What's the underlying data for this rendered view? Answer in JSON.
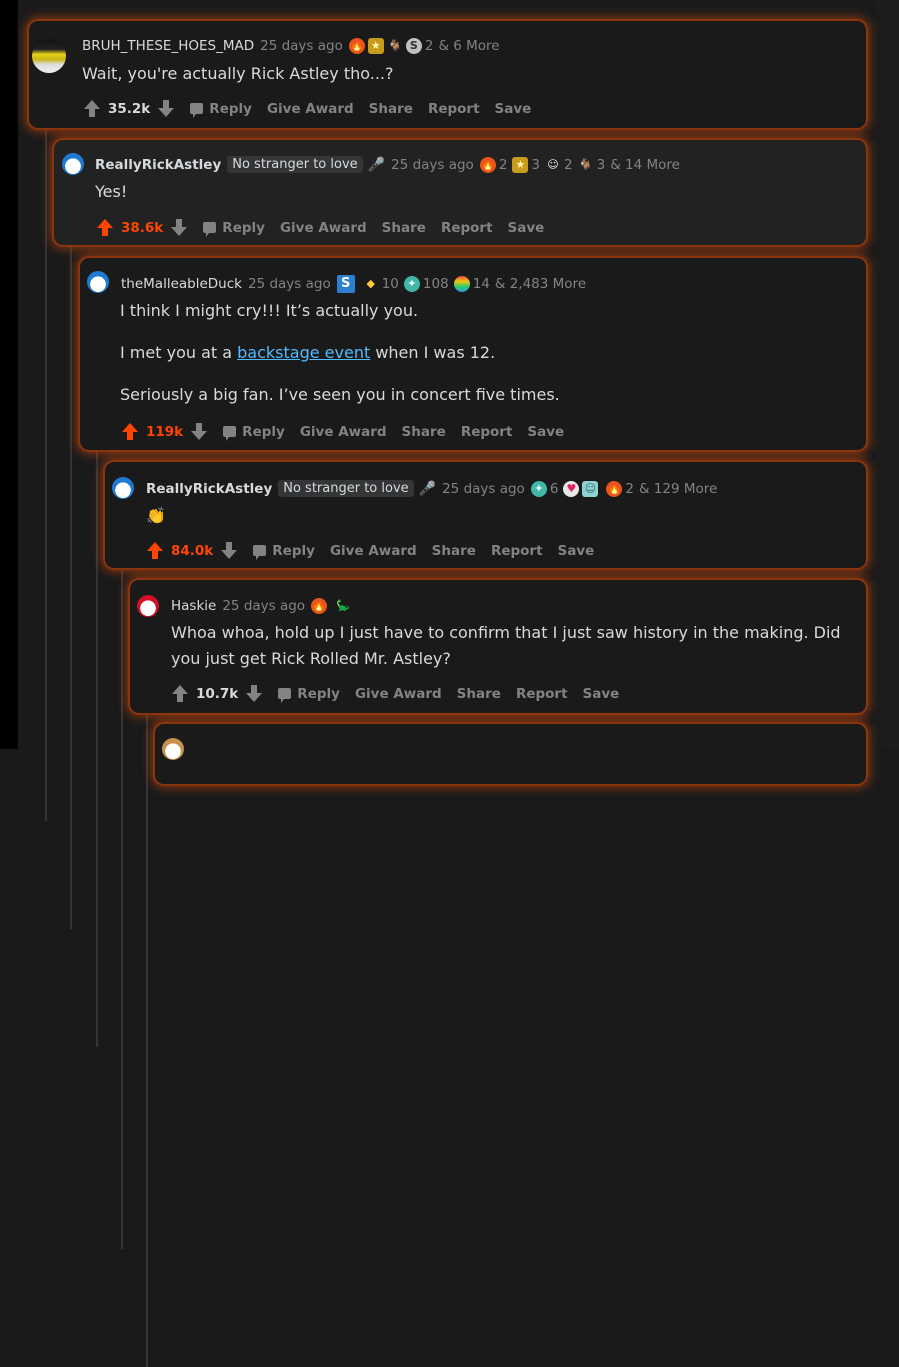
{
  "comments": [
    {
      "username": "BRUH_THESE_HOES_MAD",
      "time": "25 days ago",
      "awards": [
        {
          "icon": "fire-award-icon",
          "glyph": "🔥",
          "count": ""
        },
        {
          "icon": "gold-award-icon",
          "glyph": "★",
          "count": ""
        },
        {
          "icon": "goat-award-icon",
          "glyph": "🐐",
          "count": ""
        },
        {
          "icon": "silver-award-icon",
          "glyph": "S",
          "count": "2"
        }
      ],
      "more": "& 6 More",
      "body": [
        "Wait, you're actually Rick Astley tho...?"
      ],
      "score": "35.2k",
      "upvoted": false
    },
    {
      "username": "ReallyRickAstley",
      "flair": "No stranger to love",
      "flair_icon": "microphone-icon",
      "time": "25 days ago",
      "awards": [
        {
          "icon": "fire-award-icon",
          "glyph": "🔥",
          "count": "2"
        },
        {
          "icon": "gold-award-icon",
          "glyph": "★",
          "count": "3"
        },
        {
          "icon": "wholesome-award-icon",
          "glyph": "☺",
          "count": "2"
        },
        {
          "icon": "goat-award-icon",
          "glyph": "🐐",
          "count": "3"
        }
      ],
      "more": "& 14 More",
      "body": [
        "Yes!"
      ],
      "score": "38.6k",
      "upvoted": true
    },
    {
      "username": "theMalleableDuck",
      "time": "25 days ago",
      "awards": [
        {
          "icon": "silver-award-icon",
          "glyph": "S",
          "count": ""
        },
        {
          "icon": "gem-award-icon",
          "glyph": "◆",
          "count": "10"
        },
        {
          "icon": "platinum-award-icon",
          "glyph": "✦",
          "count": "108"
        },
        {
          "icon": "rainbow-award-icon",
          "glyph": "🌈",
          "count": "14"
        }
      ],
      "more": "& 2,483 More",
      "body_p1": "I think I might cry!!! It’s actually you.",
      "body_p2_before": "I met you at a ",
      "body_p2_link": "backstage event",
      "body_p2_after": " when I was 12.",
      "body_p3": "Seriously a big fan. I’ve seen you in concert five times.",
      "score": "119k",
      "upvoted": true
    },
    {
      "username": "ReallyRickAstley",
      "flair": "No stranger to love",
      "flair_icon": "microphone-icon",
      "time": "25 days ago",
      "awards": [
        {
          "icon": "platinum-award-icon",
          "glyph": "✦",
          "count": "6"
        },
        {
          "icon": "heart-eyes-award-icon",
          "glyph": "😍",
          "count": ""
        },
        {
          "icon": "helpful-award-icon",
          "glyph": "☺",
          "count": ""
        },
        {
          "icon": "fire-award-icon",
          "glyph": "🔥",
          "count": "2"
        }
      ],
      "more": "& 129 More",
      "body": [
        "👏"
      ],
      "score": "84.0k",
      "upvoted": true
    },
    {
      "username": "Haskie",
      "time": "25 days ago",
      "awards": [
        {
          "icon": "fire-award-icon",
          "glyph": "🔥",
          "count": ""
        },
        {
          "icon": "dinosaur-award-icon",
          "glyph": "🦕",
          "count": ""
        }
      ],
      "more": "",
      "body": [
        "Whoa whoa, hold up I just have to confirm that I just saw history in the making. Did you just get Rick Rolled Mr. Astley?"
      ],
      "score": "10.7k",
      "upvoted": false
    }
  ],
  "actions": {
    "reply": "Reply",
    "give_award": "Give Award",
    "share": "Share",
    "report": "Report",
    "save": "Save"
  },
  "colors": {
    "upvote": "#ff4500",
    "link": "#4fbcff",
    "glow": "#c2410c",
    "mic": "#24a0ed"
  }
}
